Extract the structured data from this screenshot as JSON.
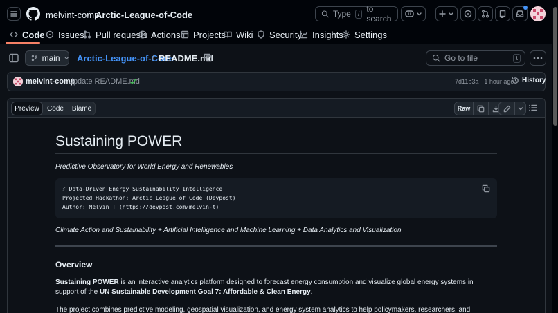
{
  "header": {
    "owner": "melvint-comp",
    "separator": "/",
    "repo": "Arctic-League-of-Code",
    "search_prefix": "Type",
    "search_key": "/",
    "search_suffix": "to search"
  },
  "repo_nav": {
    "items": [
      {
        "label": "Code",
        "icon": "code-icon"
      },
      {
        "label": "Issues",
        "icon": "issue-icon"
      },
      {
        "label": "Pull requests",
        "icon": "pull-request-icon"
      },
      {
        "label": "Actions",
        "icon": "play-icon"
      },
      {
        "label": "Projects",
        "icon": "table-icon"
      },
      {
        "label": "Wiki",
        "icon": "book-icon"
      },
      {
        "label": "Security",
        "icon": "shield-icon"
      },
      {
        "label": "Insights",
        "icon": "graph-icon"
      },
      {
        "label": "Settings",
        "icon": "gear-icon"
      }
    ],
    "active": "Code"
  },
  "file_bar": {
    "branch": "main",
    "path_repo": "Arctic-League-of-Code",
    "path_sep": "/",
    "path_file": "README.md",
    "goto_placeholder": "Go to file",
    "goto_key": "t"
  },
  "commit": {
    "author": "melvint-comp",
    "message": "Update README.md",
    "meta": "7d11b3a · 1 hour ago",
    "history_label": "History"
  },
  "file_view": {
    "tabs": [
      "Preview",
      "Code",
      "Blame"
    ],
    "active_tab": "Preview",
    "raw_label": "Raw"
  },
  "readme": {
    "title": "Sustaining POWER",
    "subtitle": "Predictive Observatory for World Energy and Renewables",
    "code_lines": [
      "⚡ Data-Driven Energy Sustainability Intelligence",
      "Projected Hackathon: Arctic League of Code (Devpost)",
      "Author: Melvin T (https://devpost.com/melvin-t)"
    ],
    "tags": "Climate Action and Sustainability + Artificial Intelligence and Machine Learning + Data Analytics and Visualization",
    "overview_heading": "Overview",
    "p1_bold1": "Sustaining POWER",
    "p1_text1": " is an interactive analytics platform designed to forecast energy consumption and visualize global energy systems in support of the ",
    "p1_bold2": "UN Sustainable Development Goal 7: Affordable & Clean Energy",
    "p1_text2": ".",
    "p2": "The project combines predictive modeling, geospatial visualization, and energy system analytics to help policymakers, researchers, and"
  },
  "colors": {
    "accent_link": "#4493f8",
    "active_underline": "#f78166",
    "success": "#3fb950"
  }
}
